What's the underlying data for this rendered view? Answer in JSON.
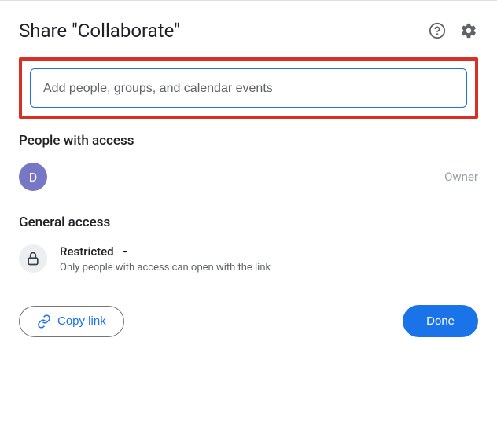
{
  "header": {
    "title": "Share \"Collaborate\""
  },
  "input": {
    "placeholder": "Add people, groups, and calendar events",
    "value": ""
  },
  "people": {
    "section_title": "People with access",
    "owner": {
      "initial": "D",
      "role": "Owner"
    }
  },
  "general": {
    "section_title": "General access",
    "selected": "Restricted",
    "description": "Only people with access can open with the link"
  },
  "footer": {
    "copy_link": "Copy link",
    "done": "Done"
  }
}
